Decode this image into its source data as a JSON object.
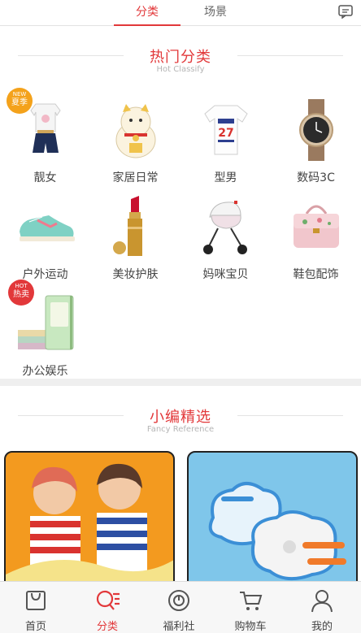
{
  "top_tabs": [
    {
      "label": "分类",
      "active": true
    },
    {
      "label": "场景",
      "active": false
    }
  ],
  "hot_section": {
    "title": "热门分类",
    "subtitle": "Hot Classify",
    "categories": [
      {
        "label": "靓女",
        "badge_top": "NEW",
        "badge_main": "夏季"
      },
      {
        "label": "家居日常"
      },
      {
        "label": "型男"
      },
      {
        "label": "数码3C"
      },
      {
        "label": "户外运动"
      },
      {
        "label": "美妆护肤"
      },
      {
        "label": "妈咪宝贝"
      },
      {
        "label": "鞋包配饰"
      },
      {
        "label": "办公娱乐",
        "badge_top": "HOT",
        "badge_main": "热卖"
      }
    ]
  },
  "fancy_section": {
    "title": "小编精选",
    "subtitle": "Fancy Reference"
  },
  "bottom_nav": [
    {
      "label": "首页",
      "icon": "bag-icon",
      "active": false
    },
    {
      "label": "分类",
      "icon": "category-search-icon",
      "active": true
    },
    {
      "label": "福利社",
      "icon": "target-icon",
      "active": false
    },
    {
      "label": "购物车",
      "icon": "cart-icon",
      "active": false
    },
    {
      "label": "我的",
      "icon": "user-icon",
      "active": false
    }
  ],
  "colors": {
    "accent": "#e2383a",
    "badge_new": "#f4a21b"
  }
}
